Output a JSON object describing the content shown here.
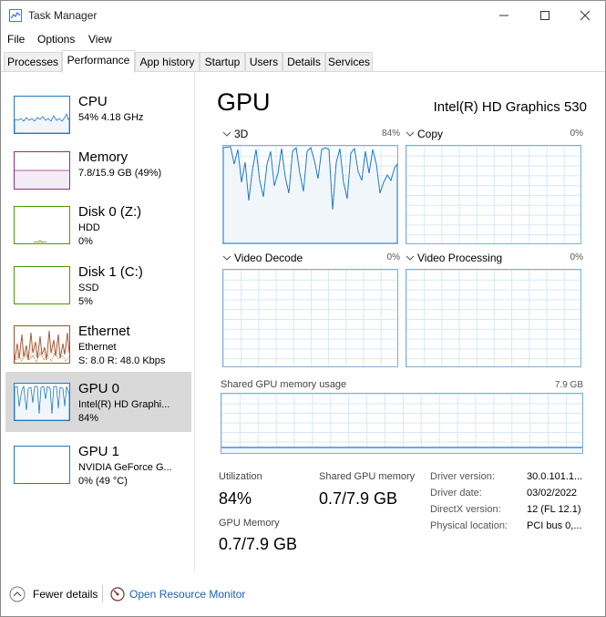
{
  "window": {
    "title": "Task Manager"
  },
  "menu": [
    "File",
    "Options",
    "View"
  ],
  "tabs": [
    "Processes",
    "Performance",
    "App history",
    "Startup",
    "Users",
    "Details",
    "Services"
  ],
  "active_tab": "Performance",
  "sidebar": [
    {
      "name": "CPU",
      "line2": "54%  4.18 GHz",
      "line3": "",
      "color": "#1e78c8"
    },
    {
      "name": "Memory",
      "line2": "7.8/15.9 GB (49%)",
      "line3": "",
      "color": "#8b2d8b"
    },
    {
      "name": "Disk 0 (Z:)",
      "line2": "HDD",
      "line3": "0%",
      "color": "#4e9a06"
    },
    {
      "name": "Disk 1 (C:)",
      "line2": "SSD",
      "line3": "5%",
      "color": "#4e9a06"
    },
    {
      "name": "Ethernet",
      "line2": "Ethernet",
      "line3": "S: 8.0  R: 48.0 Kbps",
      "color": "#a0522d"
    },
    {
      "name": "GPU 0",
      "line2": "Intel(R) HD Graphi...",
      "line3": "84%",
      "color": "#1e78c8"
    },
    {
      "name": "GPU 1",
      "line2": "NVIDIA GeForce G...",
      "line3": "0%  (49 °C)",
      "color": "#1e78c8"
    }
  ],
  "detail": {
    "title": "GPU",
    "model": "Intel(R) HD Graphics 530",
    "engines": [
      {
        "label": "3D",
        "pct": "84%"
      },
      {
        "label": "Copy",
        "pct": "0%"
      },
      {
        "label": "Video Decode",
        "pct": "0%"
      },
      {
        "label": "Video Processing",
        "pct": "0%"
      }
    ],
    "shared_mem_label": "Shared GPU memory usage",
    "shared_mem_max": "7.9 GB",
    "stats": {
      "utilization_label": "Utilization",
      "utilization": "84%",
      "shared_label": "Shared GPU memory",
      "shared": "0.7/7.9 GB",
      "gpumem_label": "GPU Memory",
      "gpumem": "0.7/7.9 GB"
    },
    "driver": [
      {
        "k": "Driver version:",
        "v": "30.0.101.1..."
      },
      {
        "k": "Driver date:",
        "v": "03/02/2022"
      },
      {
        "k": "DirectX version:",
        "v": "12 (FL 12.1)"
      },
      {
        "k": "Physical location:",
        "v": "PCI bus 0,..."
      }
    ]
  },
  "footer": {
    "fewer": "Fewer details",
    "monitor": "Open Resource Monitor"
  },
  "colors": {
    "gpu_line": "#1e78c8",
    "gpu_fill": "#f1f6fb",
    "graph_border": "#7cafd9",
    "link": "#1a5fb4"
  }
}
